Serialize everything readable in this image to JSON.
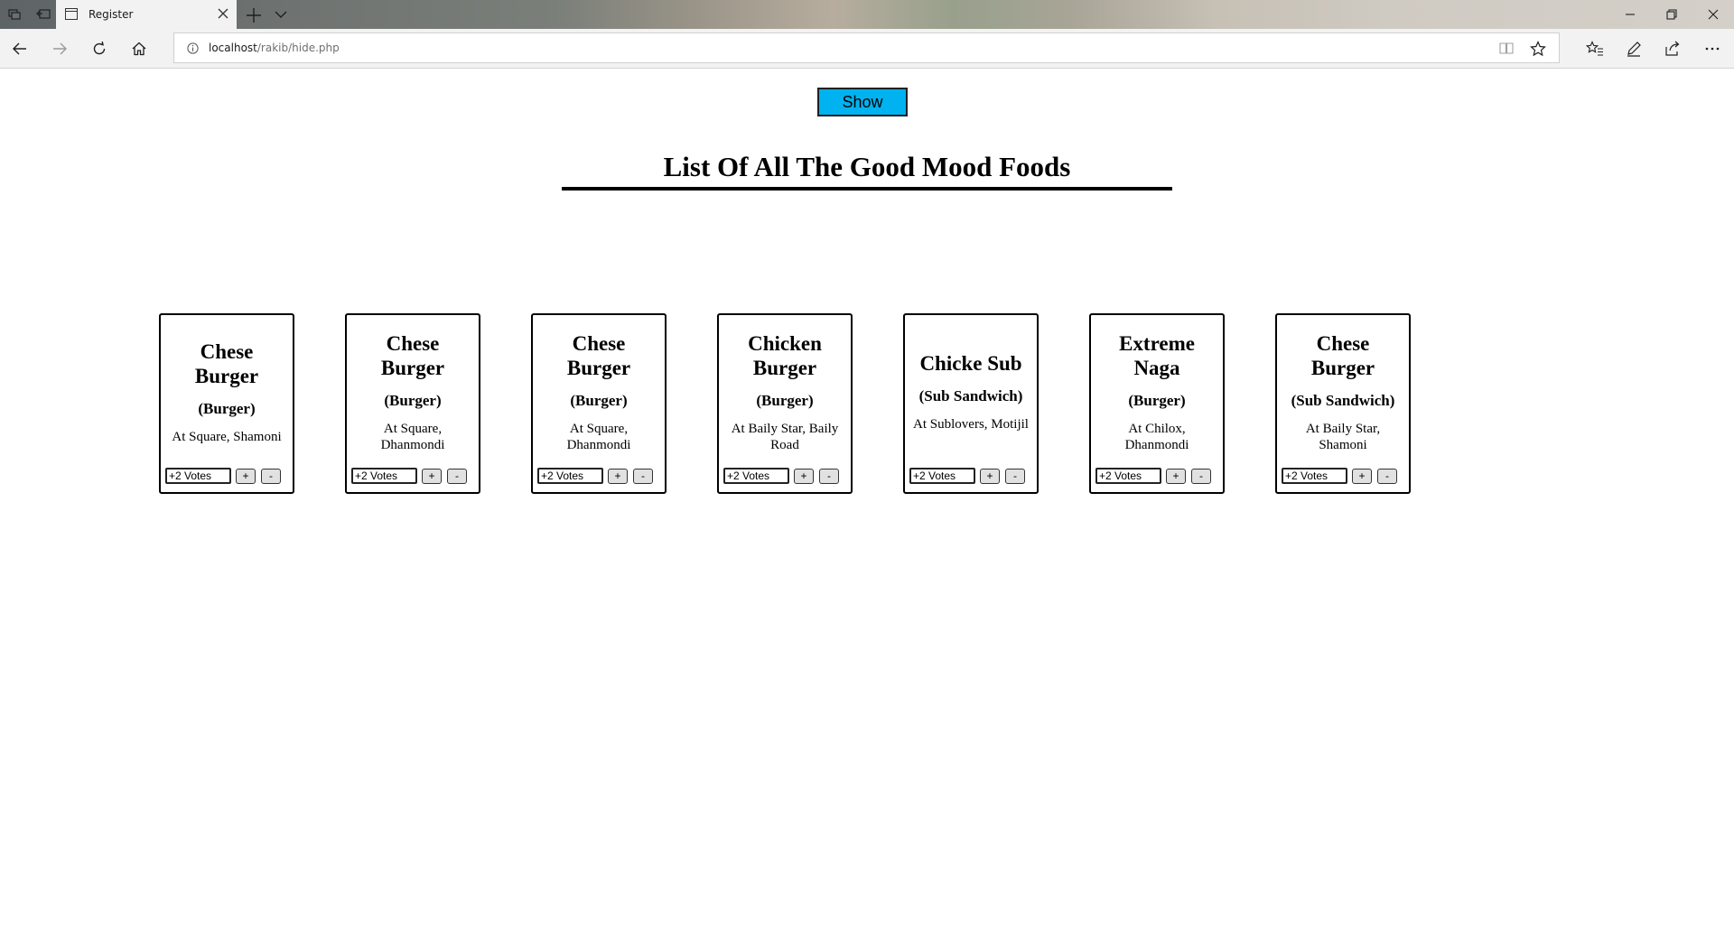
{
  "browser": {
    "tab_title": "Register",
    "url_host": "localhost",
    "url_path": "/rakib/hide.php"
  },
  "page": {
    "show_button_label": "Show",
    "heading": "List Of All The Good Mood Foods",
    "foods": [
      {
        "name": "Chese Burger",
        "category": "(Burger)",
        "location": "At Square, Shamoni",
        "votes": "+2 Votes",
        "plus": "+",
        "minus": "-"
      },
      {
        "name": "Chese Burger",
        "category": "(Burger)",
        "location": "At Square, Dhanmondi",
        "votes": "+2 Votes",
        "plus": "+",
        "minus": "-"
      },
      {
        "name": "Chese Burger",
        "category": "(Burger)",
        "location": "At Square, Dhanmondi",
        "votes": "+2 Votes",
        "plus": "+",
        "minus": "-"
      },
      {
        "name": "Chicken Burger",
        "category": "(Burger)",
        "location": "At Baily Star, Baily Road",
        "votes": "+2 Votes",
        "plus": "+",
        "minus": "-"
      },
      {
        "name": "Chicke Sub",
        "category": "(Sub Sandwich)",
        "location": "At Sublovers, Motijil",
        "votes": "+2 Votes",
        "plus": "+",
        "minus": "-"
      },
      {
        "name": "Extreme Naga",
        "category": "(Burger)",
        "location": "At Chilox, Dhanmondi",
        "votes": "+2 Votes",
        "plus": "+",
        "minus": "-"
      },
      {
        "name": "Chese Burger",
        "category": "(Sub Sandwich)",
        "location": "At Baily Star, Shamoni",
        "votes": "+2 Votes",
        "plus": "+",
        "minus": "-"
      }
    ]
  },
  "colors": {
    "show_button": "#00b2ef"
  }
}
